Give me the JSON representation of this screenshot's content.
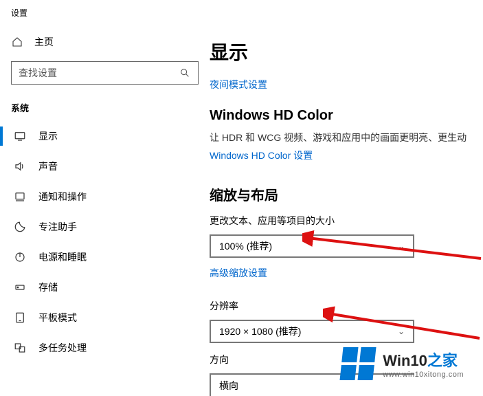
{
  "app_title": "设置",
  "home_label": "主页",
  "search_placeholder": "查找设置",
  "system_label": "系统",
  "nav": [
    {
      "label": "显示"
    },
    {
      "label": "声音"
    },
    {
      "label": "通知和操作"
    },
    {
      "label": "专注助手"
    },
    {
      "label": "电源和睡眠"
    },
    {
      "label": "存储"
    },
    {
      "label": "平板模式"
    },
    {
      "label": "多任务处理"
    }
  ],
  "main": {
    "page_title": "显示",
    "night_mode_link": "夜间模式设置",
    "hd_color_title": "Windows HD Color",
    "hd_color_desc": "让 HDR 和 WCG 视频、游戏和应用中的画面更明亮、更生动",
    "hd_color_link": "Windows HD Color 设置",
    "scale_title": "缩放与布局",
    "scale_label": "更改文本、应用等项目的大小",
    "scale_value": "100% (推荐)",
    "advanced_scale_link": "高级缩放设置",
    "resolution_label": "分辨率",
    "resolution_value": "1920 × 1080 (推荐)",
    "orientation_label": "方向",
    "orientation_value": "横向"
  },
  "watermark": {
    "brand_pre": "Win10",
    "brand_post": "之家",
    "url": "www.win10xitong.com"
  }
}
